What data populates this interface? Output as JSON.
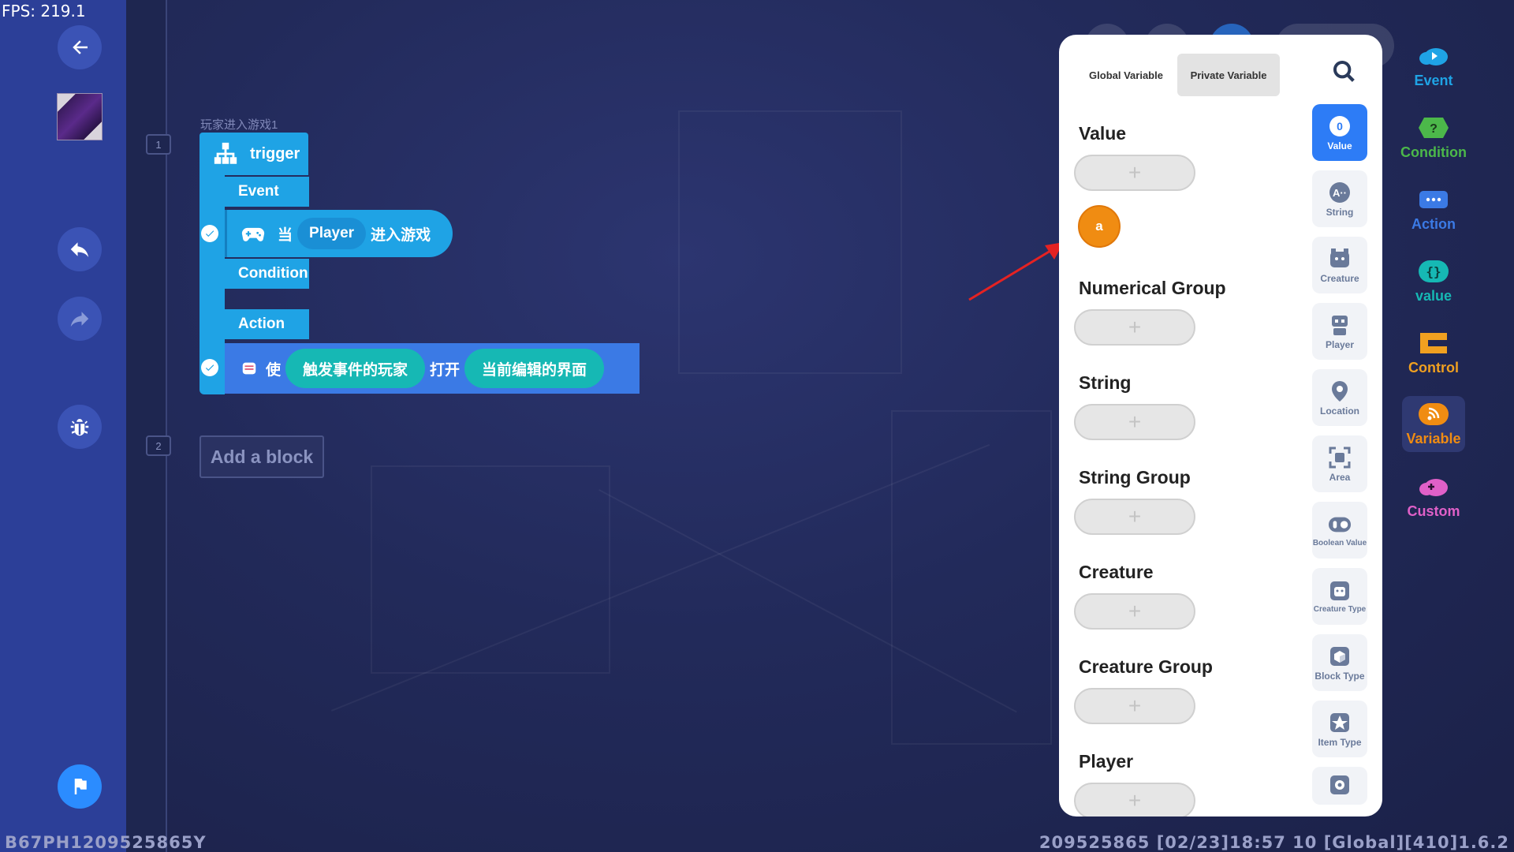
{
  "hud": {
    "fps": "FPS: 219.1",
    "device_id": "B67PH1209525865Y",
    "status": "209525865   [02/23]18:57 10  [Global][410]1.6.2"
  },
  "editor": {
    "line_numbers": [
      "1",
      "2"
    ],
    "trigger_caption": "玩家进入游戏1",
    "trigger_label": "trigger",
    "event_label": "Event",
    "event_statement": {
      "prefix": "当",
      "param": "Player",
      "suffix": "进入游戏"
    },
    "condition_label": "Condition",
    "action_label": "Action",
    "action_statement": {
      "prefix": "使",
      "param1": "触发事件的玩家",
      "middle": "打开",
      "param2": "当前编辑的界面"
    },
    "add_block_label": "Add a block"
  },
  "categories": [
    {
      "label": "Event",
      "color": "#1fa3e5"
    },
    {
      "label": "Condition",
      "color": "#4cb84a"
    },
    {
      "label": "Action",
      "color": "#3b7ae5"
    },
    {
      "label": "value",
      "color": "#16b8b4"
    },
    {
      "label": "Control",
      "color": "#f0a020"
    },
    {
      "label": "Variable",
      "color": "#f08c12"
    },
    {
      "label": "Custom",
      "color": "#e060c8"
    }
  ],
  "variable_panel": {
    "tabs": [
      "Global Variable",
      "Private Variable"
    ],
    "active_tab": "Private Variable",
    "sections": [
      "Value",
      "Numerical Group",
      "String",
      "String Group",
      "Creature",
      "Creature Group",
      "Player"
    ],
    "add_symbol": "+",
    "value_variable": "a",
    "types": [
      "Value",
      "String",
      "Creature",
      "Player",
      "Location",
      "Area",
      "Boolean Value",
      "Creature Type",
      "Block Type",
      "Item Type"
    ],
    "active_type": "Value"
  },
  "colors": {
    "sidebar": "#2c3f98",
    "accent_blue": "#2d7cf6",
    "variable_orange": "#f08c12"
  }
}
